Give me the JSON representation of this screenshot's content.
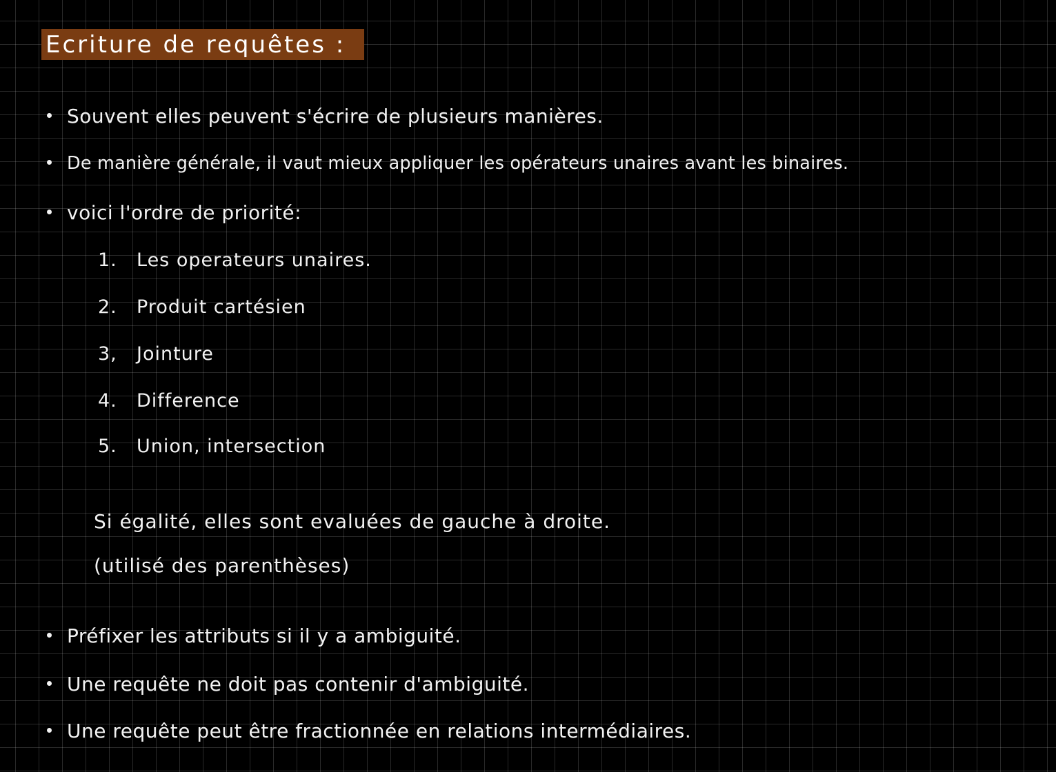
{
  "title": "Ecriture de requêtes :",
  "bullets_top": [
    "Souvent elles peuvent s'écrire de plusieurs manières.",
    "De manière générale, il vaut mieux appliquer les opérateurs unaires avant les binaires.",
    "voici l'ordre de priorité:"
  ],
  "priority_list": [
    {
      "num": "1.",
      "text": "Les operateurs unaires."
    },
    {
      "num": "2.",
      "text": "Produit cartésien"
    },
    {
      "num": "3,",
      "text": "Jointure"
    },
    {
      "num": "4.",
      "text": "Difference"
    },
    {
      "num": "5.",
      "text": "Union, intersection"
    }
  ],
  "equality_note": "Si égalité, elles sont evaluées de gauche à droite.",
  "parentheses_note": "(utilisé des parenthèses)",
  "bullets_bottom": [
    "Préfixer les attributs si il y a ambiguité.",
    "Une requête ne doit pas contenir d'ambiguité.",
    "Une requête peut être fractionnée en relations intermédiaires."
  ]
}
